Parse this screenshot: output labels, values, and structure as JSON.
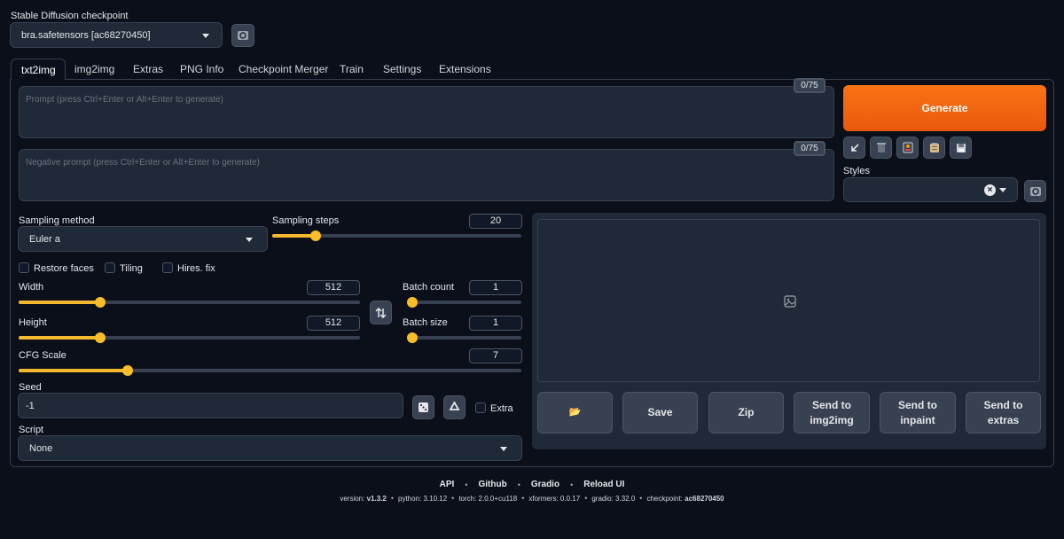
{
  "checkpoint": {
    "label": "Stable Diffusion checkpoint",
    "value": "bra.safetensors [ac68270450]"
  },
  "tabs": [
    "txt2img",
    "img2img",
    "Extras",
    "PNG Info",
    "Checkpoint Merger",
    "Train",
    "Settings",
    "Extensions"
  ],
  "active_tab": "txt2img",
  "prompt": {
    "placeholder": "Prompt (press Ctrl+Enter or Alt+Enter to generate)",
    "counter": "0/75",
    "value": ""
  },
  "negative_prompt": {
    "placeholder": "Negative prompt (press Ctrl+Enter or Alt+Enter to generate)",
    "counter": "0/75",
    "value": ""
  },
  "generate_label": "Generate",
  "toolbar_icons": [
    "arrow-down-left-icon",
    "trash-icon",
    "picture-card-icon",
    "clipboard-icon",
    "save-icon"
  ],
  "styles": {
    "label": "Styles",
    "value": ""
  },
  "sampling_method": {
    "label": "Sampling method",
    "value": "Euler a"
  },
  "sampling_steps": {
    "label": "Sampling steps",
    "value": "20",
    "fraction": 0.16
  },
  "checkboxes": {
    "restore_faces": "Restore faces",
    "tiling": "Tiling",
    "hires_fix": "Hires. fix",
    "extra": "Extra"
  },
  "width": {
    "label": "Width",
    "value": "512",
    "fraction": 0.23
  },
  "height": {
    "label": "Height",
    "value": "512",
    "fraction": 0.23
  },
  "batch_count": {
    "label": "Batch count",
    "value": "1",
    "fraction": 0.0
  },
  "batch_size": {
    "label": "Batch size",
    "value": "1",
    "fraction": 0.0
  },
  "cfg_scale": {
    "label": "CFG Scale",
    "value": "7",
    "fraction": 0.21
  },
  "seed": {
    "label": "Seed",
    "value": "-1"
  },
  "script": {
    "label": "Script",
    "value": "None"
  },
  "output_buttons": {
    "folder": "📂",
    "save": "Save",
    "zip": "Zip",
    "send_img2img_1": "Send to",
    "send_img2img_2": "img2img",
    "send_inpaint_1": "Send to",
    "send_inpaint_2": "inpaint",
    "send_extras_1": "Send to",
    "send_extras_2": "extras"
  },
  "footer": {
    "links": [
      "API",
      "Github",
      "Gradio",
      "Reload UI"
    ],
    "version_label": "version:",
    "version": "v1.3.2",
    "python": "python: 3.10.12",
    "torch": "torch: 2.0.0+cu118",
    "xformers": "xformers: 0.0.17",
    "gradio": "gradio: 3.32.0",
    "checkpoint_label": "checkpoint:",
    "checkpoint": "ac68270450"
  },
  "colors": {
    "background": "#0b0f19",
    "panel": "#1f2937",
    "accent": "#f97316",
    "slider": "#f9bd29"
  }
}
